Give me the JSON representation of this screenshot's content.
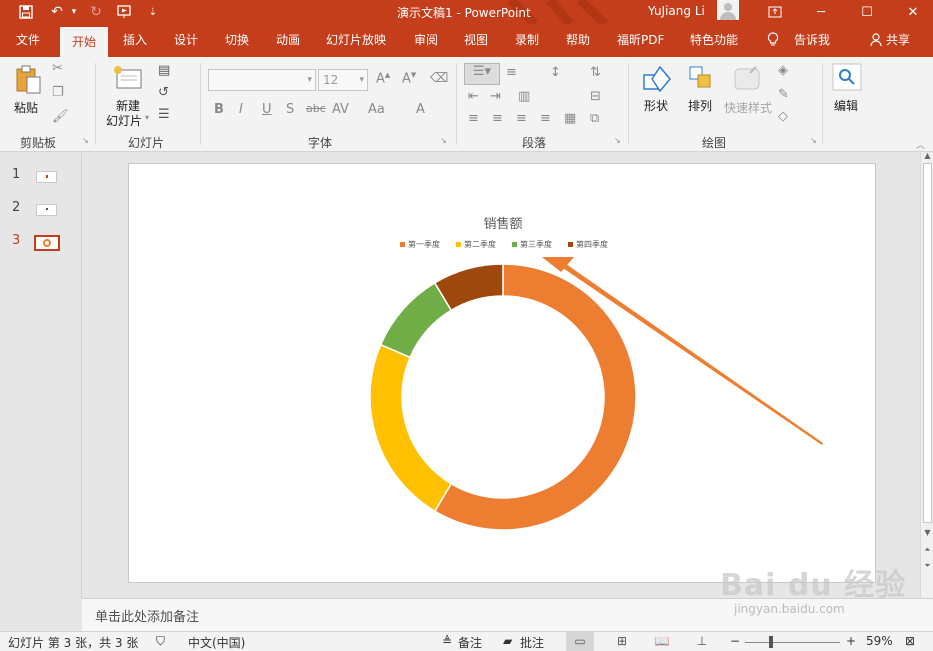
{
  "titlebar": {
    "document_title": "演示文稿1",
    "separator": "-",
    "app_name": "PowerPoint",
    "user_name": "YuJiang Li"
  },
  "tabs": [
    {
      "label": "文件"
    },
    {
      "label": "开始"
    },
    {
      "label": "插入"
    },
    {
      "label": "设计"
    },
    {
      "label": "切换"
    },
    {
      "label": "动画"
    },
    {
      "label": "幻灯片放映"
    },
    {
      "label": "审阅"
    },
    {
      "label": "视图"
    },
    {
      "label": "录制"
    },
    {
      "label": "帮助"
    },
    {
      "label": "福昕PDF"
    },
    {
      "label": "特色功能"
    },
    {
      "label": "告诉我"
    },
    {
      "label": "共享"
    }
  ],
  "ribbon": {
    "clipboard": {
      "paste_label": "粘贴",
      "group_label": "剪贴板"
    },
    "slides": {
      "new_slide_label": "新建",
      "new_slide_label2": "幻灯片",
      "group_label": "幻灯片"
    },
    "font": {
      "font_size": "12",
      "group_label": "字体"
    },
    "paragraph": {
      "group_label": "段落"
    },
    "drawing": {
      "shapes_label": "形状",
      "arrange_label": "排列",
      "quick_styles_label": "快速样式",
      "group_label": "绘图"
    },
    "editing": {
      "edit_label": "编辑"
    }
  },
  "thumbnails": [
    {
      "number": "1"
    },
    {
      "number": "2"
    },
    {
      "number": "3"
    }
  ],
  "chart_data": {
    "type": "pie",
    "subtype": "doughnut",
    "title": "销售额",
    "categories": [
      "第一季度",
      "第二季度",
      "第三季度",
      "第四季度"
    ],
    "values": [
      8.2,
      3.2,
      1.4,
      1.2
    ],
    "colors": [
      "#ed7d31",
      "#ffc000",
      "#70ad47",
      "#9e480e"
    ],
    "legend": "top"
  },
  "notes": {
    "placeholder": "单击此处添加备注"
  },
  "statusbar": {
    "slide_info": "幻灯片 第 3 张，共 3 张",
    "language": "中文(中国)",
    "notes_label": "备注",
    "comments_label": "批注",
    "zoom_percent": "59%"
  },
  "watermark": {
    "logo_text": "Bai du 经验",
    "url": "jingyan.baidu.com"
  }
}
